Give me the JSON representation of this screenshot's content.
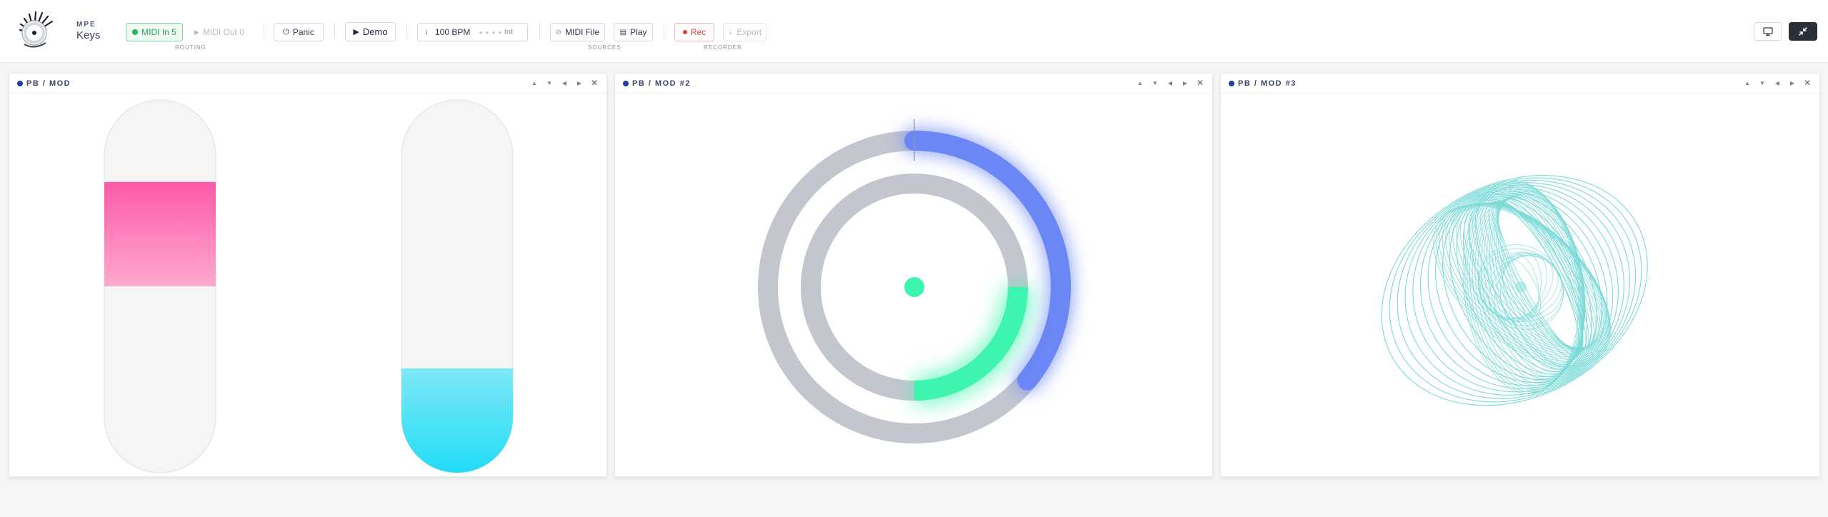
{
  "brand": {
    "small": "MPE",
    "name": "Keys"
  },
  "toolbar": {
    "midi_in": "MIDI In 5",
    "midi_out": "MIDI Out 0",
    "routing_label": "ROUTING",
    "panic": "Panic",
    "demo": "Demo",
    "tempo": "100 BPM",
    "beats": "● ● ● ●",
    "clock": "Int",
    "midi_file": "MIDI File",
    "play": "Play",
    "sources_label": "SOURCES",
    "rec": "Rec",
    "export": "Export",
    "recorder_label": "RECORDER"
  },
  "panels": [
    {
      "title": "PB / MOD"
    },
    {
      "title": "PB / MOD #2"
    },
    {
      "title": "PB / MOD #3"
    }
  ],
  "panel1": {
    "pitch_bend_fill": {
      "from": 0.22,
      "to": 0.5,
      "color_top": "#ff5aa8",
      "color_bottom": "#ffa9cf"
    },
    "mod_fill": {
      "level": 0.28,
      "color_top": "#7ee8f5",
      "color_bottom": "#22dcf8"
    }
  },
  "panel2": {
    "outer_ring_value": 0.36,
    "inner_ring_start": 0.25,
    "inner_ring_value": 0.5,
    "outer_color": "#6b86f5",
    "inner_color": "#3ef5b0",
    "track_color": "#c3c6cf"
  },
  "panel3": {
    "line_color": "#6dd6d4"
  },
  "colors": {
    "accent": "#1f3f9e",
    "green": "#25b45f",
    "red": "#e23d3d"
  },
  "icons": [
    "logo-icon",
    "power-icon",
    "play-icon",
    "note-icon",
    "link-icon",
    "list-icon",
    "record-icon",
    "export-icon",
    "monitor-icon",
    "collapse-icon"
  ]
}
